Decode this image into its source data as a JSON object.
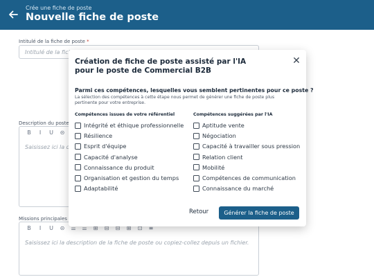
{
  "header": {
    "subtitle": "Crée une fiche de poste",
    "title": "Nouvelle fiche de poste",
    "back_icon": "arrow-left-icon",
    "bg_color": "#1c5f8a"
  },
  "form": {
    "job_title_label": "Intitulé de la fiche de poste",
    "required_mark": "*",
    "job_title_placeholder": "Intitulé de la fiche",
    "description_label": "Description du poste",
    "description_placeholder": "Saisissez ici la de",
    "missions_label": "Missions principales",
    "missions_placeholder": "Saisissez ici la description de la fiche de poste ou copiez-collez depuis un fichier.",
    "toolbar_short": [
      "B",
      "I",
      "U",
      "⊝"
    ],
    "toolbar_long": [
      "B",
      "I",
      "U",
      "⊝",
      "☰",
      "☰",
      "⊞",
      "⊟",
      "⊟",
      "⊞",
      "⊡",
      "≡"
    ]
  },
  "modal": {
    "title_line1": "Création de fiche de poste assisté par l'IA",
    "title_line2": "pour le poste de Commercial B2B",
    "close_icon": "close-icon",
    "question": "Parmi ces compétences, lesquelles vous semblent pertinentes pour ce poste ?",
    "explanation": "La sélection des compétences à cette étape nous permet de générer une fiche de poste plus pertinente pour votre entreprise.",
    "left_heading": "Compétences issues de votre référentiel",
    "right_heading": "Compétences suggérées par l'IA",
    "left_items": [
      "Intégrité et éthique professionnelle",
      "Résilience",
      "Esprit d'équipe",
      "Capacité d'analyse",
      "Connaissance du produit",
      "Organisation et gestion du temps",
      "Adaptabilité"
    ],
    "right_items": [
      "Aptitude vente",
      "Négociation",
      "Capacité à travailler sous pression",
      "Relation client",
      "Mobilité",
      "Compétences de communication",
      "Connaissance du marché"
    ],
    "back_label": "Retour",
    "generate_label": "Générer la fiche de poste",
    "accent_color": "#1c5f8a"
  }
}
